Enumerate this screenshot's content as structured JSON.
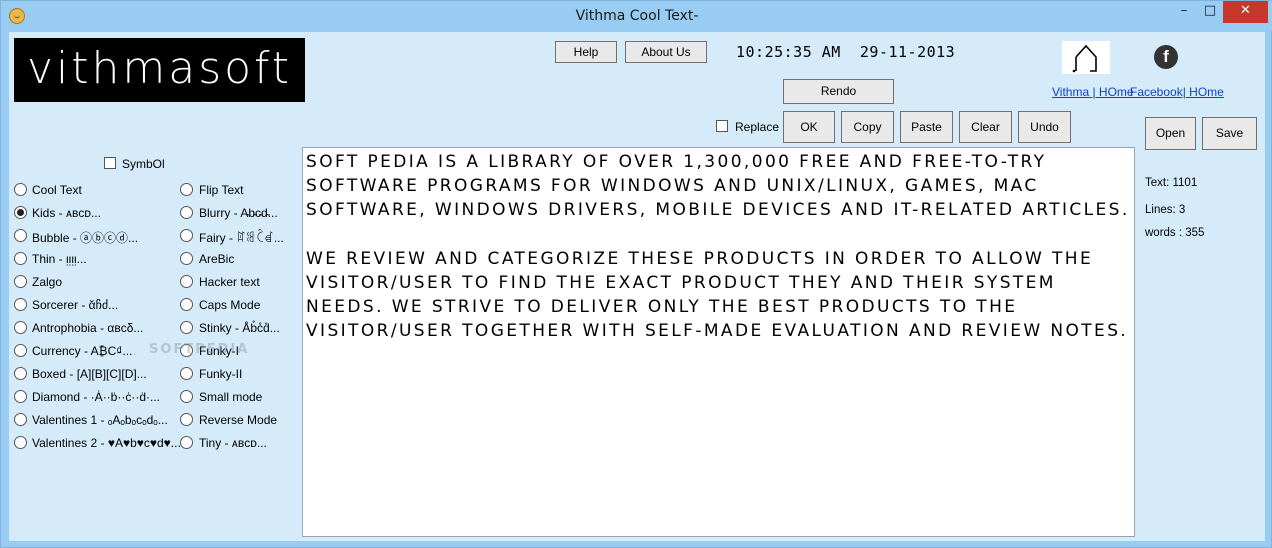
{
  "window": {
    "title": "Vithma Cool Text-",
    "controls": {
      "minimize": "–",
      "maximize": "□",
      "close": "✕"
    }
  },
  "logo": {
    "text": "vithmasoft"
  },
  "header": {
    "help_label": "Help",
    "about_label": "About Us",
    "time": "10:25:35 AM",
    "date": "29-11-2013",
    "rendo_label": "Rendo"
  },
  "links": {
    "vithma_home": "Vithma | HOme",
    "facebook_home": "Facebook| HOme"
  },
  "toolbar": {
    "replace_label": "Replace",
    "ok_label": "OK",
    "copy_label": "Copy",
    "paste_label": "Paste",
    "clear_label": "Clear",
    "undo_label": "Undo"
  },
  "file": {
    "open_label": "Open",
    "save_label": "Save"
  },
  "symbol_label": "SymbOl",
  "styles_left": [
    {
      "label": "Cool Text",
      "selected": false
    },
    {
      "label": "Kids - ᴀʙᴄᴅ...",
      "selected": true
    },
    {
      "label": "Bubble - ⓐⓑⓒⓓ...",
      "selected": false
    },
    {
      "label": "Thin - ᴉᴉᴉᴉ...",
      "selected": false
    },
    {
      "label": "Zalgo",
      "selected": false
    },
    {
      "label": "Sorcerer - ᾰჩძ...",
      "selected": false
    },
    {
      "label": "Antrophobia - αвcδ...",
      "selected": false
    },
    {
      "label": "Currency - A₿C₫...",
      "selected": false
    },
    {
      "label": "Boxed - [A][B][C][D]...",
      "selected": false
    },
    {
      "label": "Diamond - ·Ȧ··ḃ··ċ··ḋ·...",
      "selected": false
    },
    {
      "label": "Valentines 1 - ₒAₒbₒcₒdₒ...",
      "selected": false
    },
    {
      "label": "Valentines 2 - ♥A♥b♥c♥d♥...",
      "selected": false
    }
  ],
  "styles_right": [
    {
      "label": "Flip Text",
      "selected": false
    },
    {
      "label": "Blurry - A̴b̴c̴d̴...",
      "selected": false
    },
    {
      "label": "Fairy - ꍏꌃꉓꀸ...",
      "selected": false
    },
    {
      "label": "AreBic",
      "selected": false
    },
    {
      "label": "Hacker text",
      "selected": false
    },
    {
      "label": "Caps Mode",
      "selected": false
    },
    {
      "label": "Stinky - Åb̊c̊d̊...",
      "selected": false
    },
    {
      "label": "Funky-I",
      "selected": false
    },
    {
      "label": "Funky-II",
      "selected": false
    },
    {
      "label": "Small mode",
      "selected": false
    },
    {
      "label": "Reverse Mode",
      "selected": false
    },
    {
      "label": "Tiny - ᴀʙᴄᴅ...",
      "selected": false
    }
  ],
  "editor": {
    "text": "SOFT PEDIA IS A LIBRARY OF OVER 1,300,000 FREE AND FREE-TO-TRY SOFTWARE PROGRAMS FOR WINDOWS AND UNIX/LINUX, GAMES, MAC SOFTWARE, WINDOWS DRIVERS, MOBILE DEVICES AND IT-RELATED ARTICLES.\n\nWE REVIEW AND CATEGORIZE THESE PRODUCTS IN ORDER TO ALLOW THE VISITOR/USER TO FIND THE EXACT PRODUCT THEY AND THEIR SYSTEM NEEDS. WE STRIVE TO DELIVER ONLY THE BEST PRODUCTS TO THE VISITOR/USER TOGETHER WITH SELF-MADE EVALUATION AND REVIEW NOTES."
  },
  "stats": {
    "text_count": "Text: 1101",
    "lines_count": "Lines: 3",
    "words_count": "words : 355"
  },
  "watermark": "SOFTPEDIA"
}
